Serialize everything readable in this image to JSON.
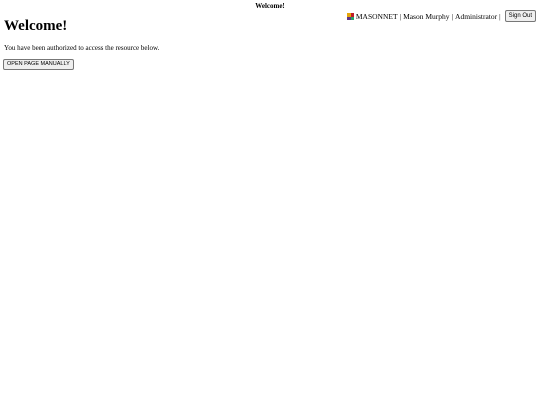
{
  "header": {
    "title": "Welcome!"
  },
  "user_bar": {
    "org": "MASONNET",
    "user": "Mason Murphy",
    "role": "Administrator",
    "separator": "|",
    "sign_out_label": "Sign Out",
    "logo_icon": "masonnet-logo-icon"
  },
  "main": {
    "heading": "Welcome!",
    "message": "You have been authorized to access the resource below.",
    "open_button_label": "OPEN PAGE MANUALLY"
  }
}
